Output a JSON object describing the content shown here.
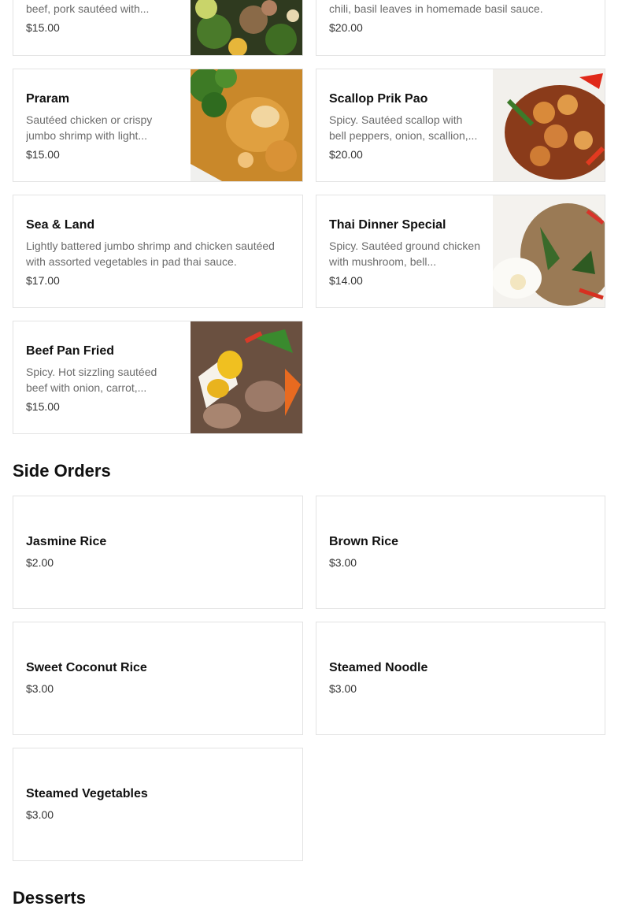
{
  "sections": {
    "side_orders": "Side Orders",
    "desserts": "Desserts"
  },
  "items": {
    "top_left": {
      "desc": "beef, pork sautéed with...",
      "price": "$15.00"
    },
    "top_right": {
      "desc": "chili, basil leaves in homemade basil sauce.",
      "price": "$20.00"
    },
    "praram": {
      "name": "Praram",
      "desc": "Sautéed chicken or crispy jumbo shrimp with light...",
      "price": "$15.00"
    },
    "scallop": {
      "name": "Scallop Prik Pao",
      "desc": "Spicy. Sautéed scallop with bell peppers, onion, scallion,...",
      "price": "$20.00"
    },
    "sea_land": {
      "name": "Sea & Land",
      "desc": "Lightly battered jumbo shrimp and chicken sautéed with assorted vegetables in pad thai sauce.",
      "price": "$17.00"
    },
    "thai_dinner": {
      "name": "Thai Dinner Special",
      "desc": "Spicy. Sautéed ground chicken with mushroom, bell...",
      "price": "$14.00"
    },
    "beef_pan": {
      "name": "Beef Pan Fried",
      "desc": "Spicy. Hot sizzling sautéed beef with onion, carrot,...",
      "price": "$15.00"
    },
    "jasmine": {
      "name": "Jasmine Rice",
      "price": "$2.00"
    },
    "brown": {
      "name": "Brown Rice",
      "price": "$3.00"
    },
    "coconut": {
      "name": "Sweet Coconut Rice",
      "price": "$3.00"
    },
    "noodle": {
      "name": "Steamed Noodle",
      "price": "$3.00"
    },
    "vegetables": {
      "name": "Steamed Vegetables",
      "price": "$3.00"
    }
  }
}
